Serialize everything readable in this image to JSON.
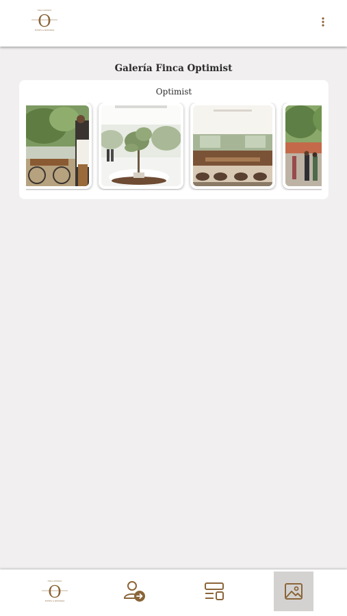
{
  "app": {
    "title": "Galería Finca Optimist",
    "brand_letter": "O",
    "brand_top": "FINCA OPTIMIST",
    "brand_bottom": "EVENTS & WEDDINGS"
  },
  "gallery": {
    "subtitle": "Optimist",
    "images": [
      {
        "name": "photo-bicycle-couple",
        "description": "people with bicycle"
      },
      {
        "name": "photo-olive-tree",
        "description": "olive tree centerpiece"
      },
      {
        "name": "photo-banquet-hall",
        "description": "dining room tables"
      },
      {
        "name": "photo-garden-party",
        "description": "outdoor party guests"
      }
    ]
  },
  "nav": {
    "items": [
      {
        "key": "home",
        "icon": "brand-logo-icon",
        "active": false
      },
      {
        "key": "profile",
        "icon": "user-arrow-icon",
        "active": false
      },
      {
        "key": "dashboard",
        "icon": "layout-icon",
        "active": false
      },
      {
        "key": "gallery",
        "icon": "image-icon",
        "active": true
      }
    ]
  },
  "colors": {
    "brand_brown": "#8a6438",
    "background": "#f1eff0",
    "active_tab": "#d4d2d1"
  }
}
